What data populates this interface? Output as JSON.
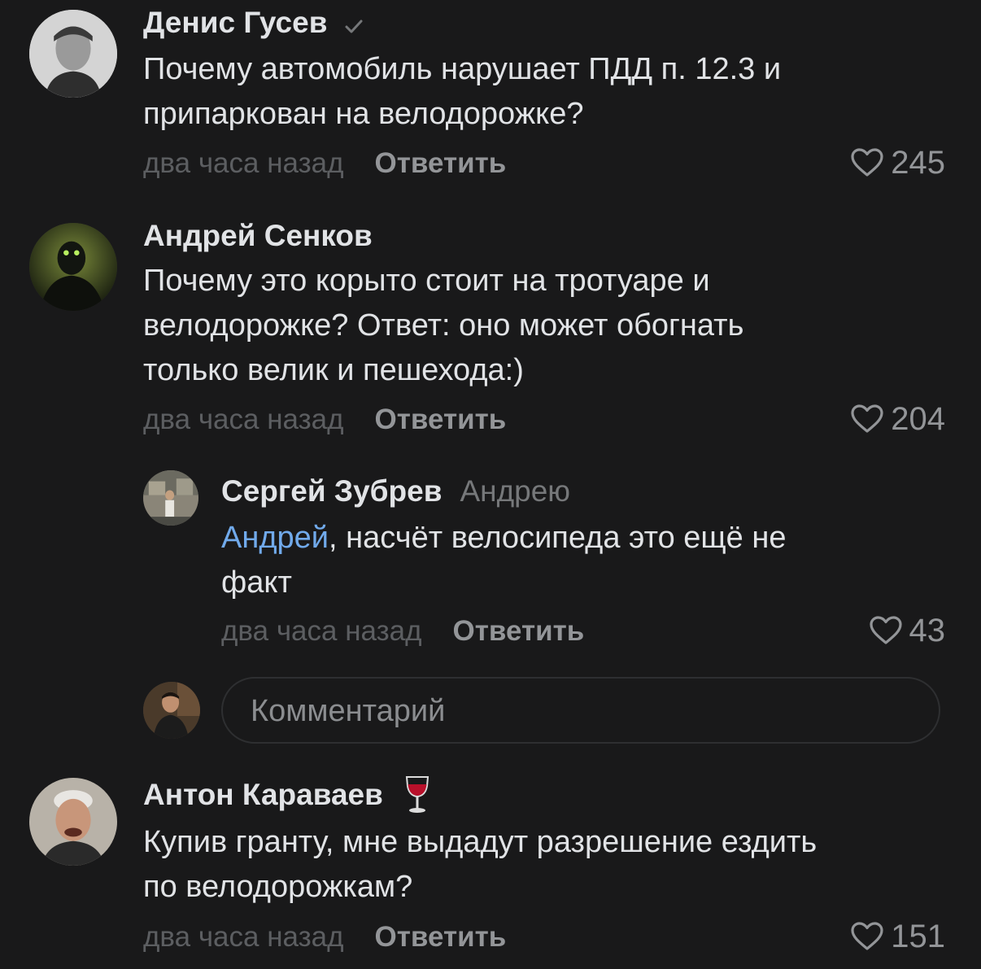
{
  "comments": [
    {
      "name": "Денис Гусев",
      "verified": true,
      "text": "Почему автомобиль нарушает ПДД п. 12.3 и\nприпаркован на велодорожке?",
      "time": "два часа назад",
      "reply_label": "Ответить",
      "likes": "245"
    },
    {
      "name": "Андрей Сенков",
      "text": "Почему это корыто стоит на тротуаре и\nвелодорожке? Ответ: оно может обогнать\nтолько велик и пешехода:)",
      "time": "два часа назад",
      "reply_label": "Ответить",
      "likes": "204"
    },
    {
      "name": "Сергей Зубрев",
      "reply_to": "Андрею",
      "mention": "Андрей",
      "text": ", насчёт велосипеда это ещё не\nфакт",
      "time": "два часа назад",
      "reply_label": "Ответить",
      "likes": "43"
    },
    {
      "name": "Антон Караваев",
      "badge_icon": "wine-glass-icon",
      "text": "Купив гранту, мне выдадут разрешение ездить\nпо велодорожкам?",
      "time": "два часа назад",
      "reply_label": "Ответить",
      "likes": "151"
    }
  ],
  "comment_input": {
    "placeholder": "Комментарий"
  },
  "colors": {
    "background": "#19191a",
    "text": "#e1e3e6",
    "secondary": "#939598",
    "time": "#5c5e61",
    "mention": "#71aaeb"
  }
}
